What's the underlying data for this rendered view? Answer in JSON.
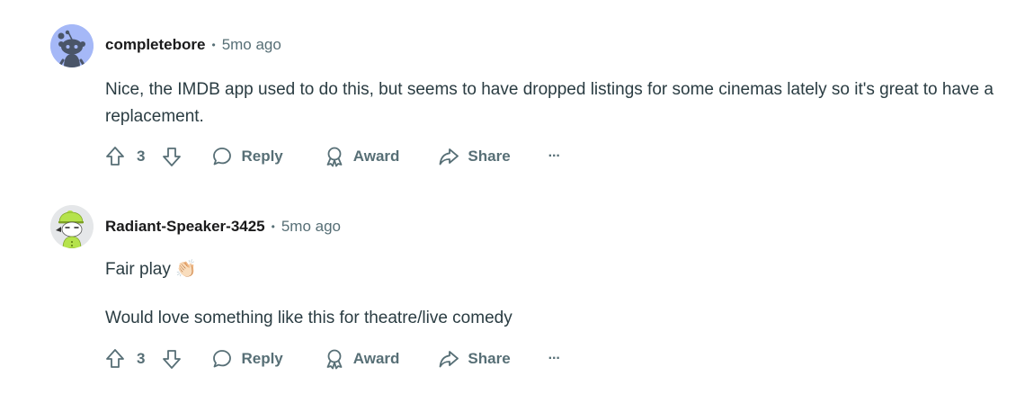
{
  "comments": [
    {
      "username": "completebore",
      "separator": "•",
      "time": "5mo ago",
      "paragraphs": [
        "Nice, the IMDB app used to do this, but seems to have dropped listings for some cinemas lately so it's great to have a replacement."
      ],
      "votes": "3",
      "reply_label": "Reply",
      "award_label": "Award",
      "share_label": "Share",
      "more_label": "···",
      "avatar_icon": "snoo-default-avatar-icon",
      "avatar_color": "#a5b8f7"
    },
    {
      "username": "Radiant-Speaker-3425",
      "separator": "•",
      "time": "5mo ago",
      "paragraphs": [
        "Fair play 👏🏻",
        "Would love something like this for theatre/live comedy"
      ],
      "votes": "3",
      "reply_label": "Reply",
      "award_label": "Award",
      "share_label": "Share",
      "more_label": "···",
      "avatar_icon": "snoo-green-hat-avatar-icon",
      "avatar_color": "#e5e7e9"
    }
  ],
  "colors": {
    "meta_gray": "#576f76",
    "body_text": "#2a3c42"
  }
}
